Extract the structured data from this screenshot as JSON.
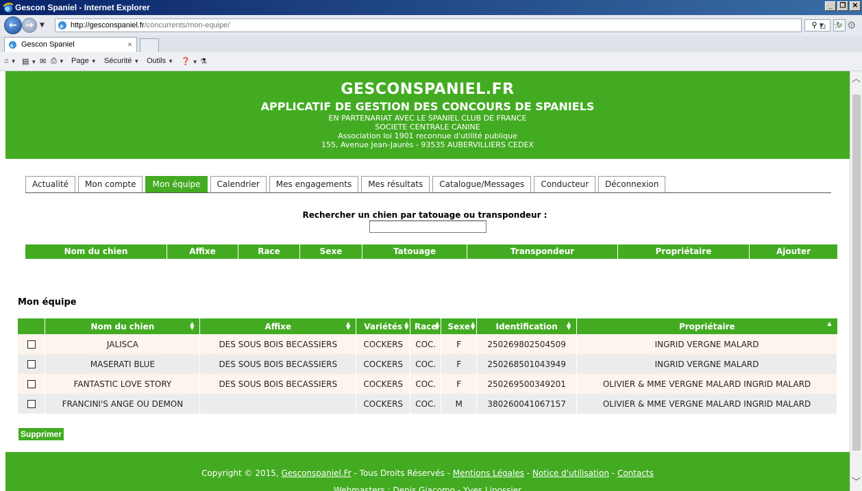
{
  "window": {
    "title": "Gescon Spaniel - Internet Explorer",
    "buttons": [
      "_",
      "×"
    ]
  },
  "browser": {
    "url_host": "http://gesconspaniel.fr",
    "url_path": "/concurrents/mon-equipe/",
    "tab_label": "Gescon Spaniel",
    "tab_close": "×",
    "commands": [
      "Page",
      "Sécurité",
      "Outils"
    ]
  },
  "banner": {
    "site": "GESCONSPANIEL.FR",
    "subtitle": "APPLICATIF DE GESTION DES CONCOURS DE SPANIELS",
    "lines": [
      "EN PARTENARIAT AVEC LE SPANIEL CLUB DE FRANCE",
      "SOCIETE CENTRALE CANINE",
      "Association loi 1901 reconnue d'utilité publique",
      "155, Avenue Jean-Jaurès - 93535 AUBERVILLIERS CEDEX"
    ]
  },
  "menu": [
    "Actualité",
    "Mon compte",
    "Mon équipe",
    "Calendrier",
    "Mes engagements",
    "Mes résultats",
    "Catalogue/Messages",
    "Conducteur",
    "Déconnexion"
  ],
  "search": {
    "label": "Rechercher un chien par tatouage ou transpondeur :",
    "value": ""
  },
  "results_headers": [
    "Nom du chien",
    "Affixe",
    "Race",
    "Sexe",
    "Tatouage",
    "Transpondeur",
    "Propriétaire",
    "Ajouter"
  ],
  "team": {
    "title": "Mon équipe",
    "headers": [
      "Nom du chien",
      "Affixe",
      "Variétés",
      "Race",
      "Sexe",
      "Identification",
      "Propriétaire"
    ],
    "rows": [
      [
        "JALISCA",
        "DES SOUS BOIS BECASSIERS",
        "COCKERS",
        "COC.",
        "F",
        "250269802504509",
        "INGRID VERGNE MALARD"
      ],
      [
        "MASERATI BLUE",
        "DES SOUS BOIS BECASSIERS",
        "COCKERS",
        "COC.",
        "F",
        "250268501043949",
        "INGRID VERGNE MALARD"
      ],
      [
        "FANTASTIC LOVE STORY",
        "DES SOUS BOIS BECASSIERS",
        "COCKERS",
        "COC.",
        "F",
        "250269500349201",
        "OLIVIER & MME VERGNE MALARD INGRID MALARD"
      ],
      [
        "FRANCINI'S ANGE OU DEMON",
        "",
        "COCKERS",
        "COC.",
        "M",
        "380260041067157",
        "OLIVIER & MME VERGNE MALARD INGRID MALARD"
      ]
    ],
    "delete_label": "Supprimer"
  },
  "footer": {
    "copyright_prefix": "Copyright © 2015,",
    "site_link": "Gesconspaniel.Fr",
    "rights": "- Tous Droits Réservés -",
    "legal_link": "Mentions Légales",
    "notice_link": "Notice d'utilisation",
    "contacts_link": "Contacts",
    "webmasters": "Webmasters : Denis Giacomo - Yves Lipossier"
  },
  "colors": {
    "brand_green": "#43ab22",
    "title_bar": "#0a246a"
  }
}
